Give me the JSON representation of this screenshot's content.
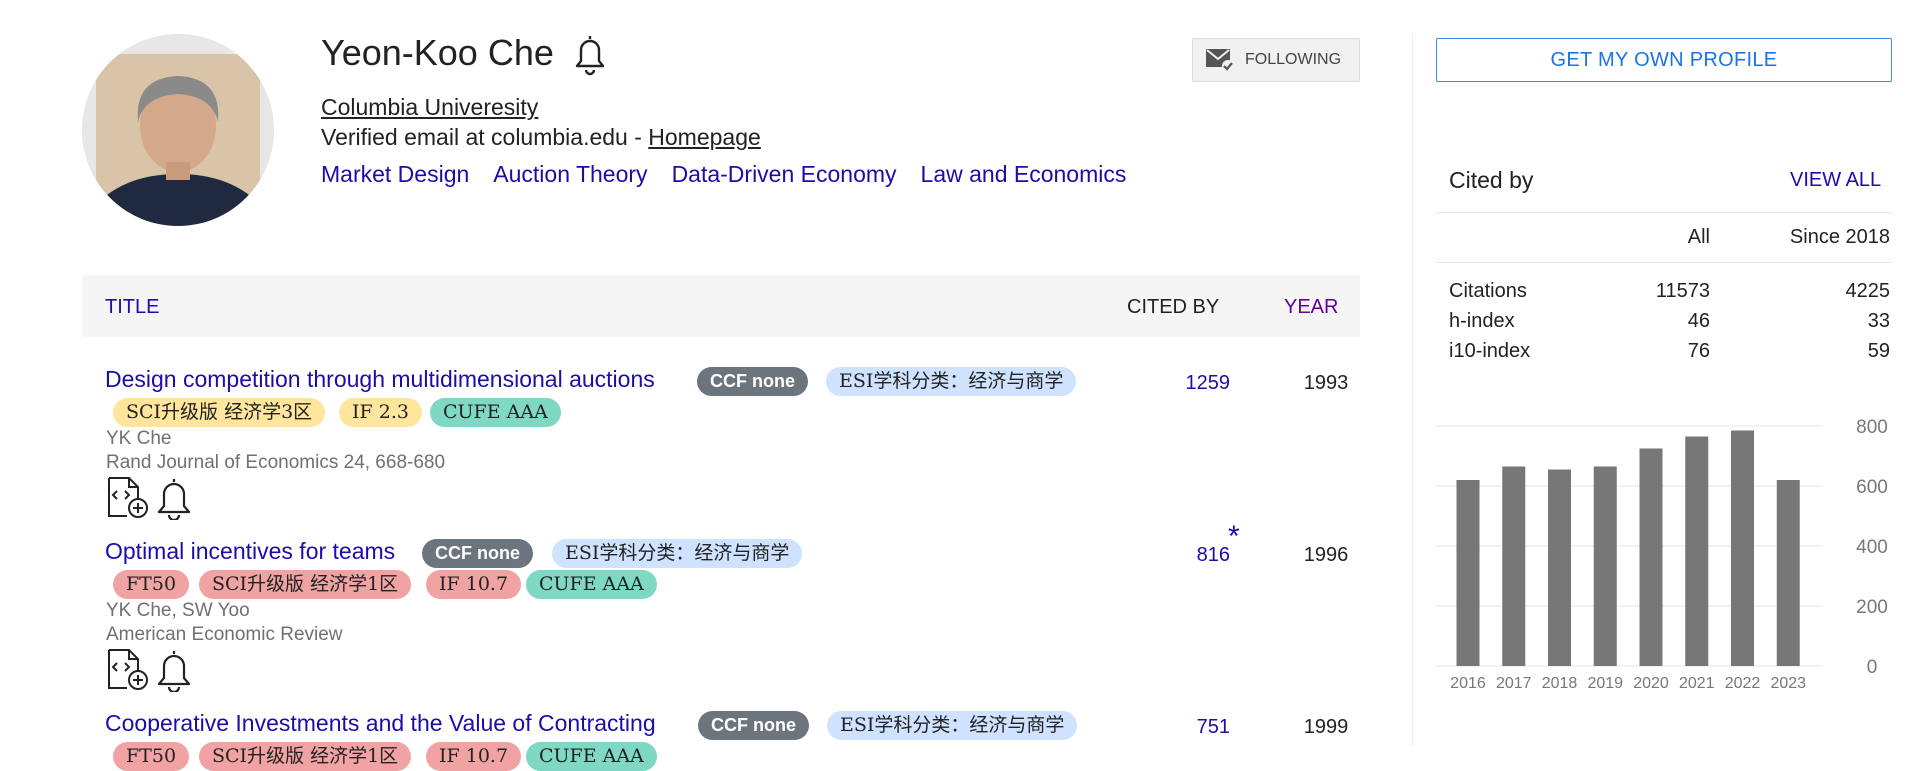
{
  "profile": {
    "name": "Yeon-Koo Che",
    "affiliation": "Columbia Univeresity",
    "email": "Verified email at columbia.edu - ",
    "homepage": "Homepage",
    "interests": [
      "Market Design",
      "Auction Theory",
      "Data-Driven Economy",
      "Law and Economics"
    ],
    "follow_label": "FOLLOWING"
  },
  "table": {
    "col_title": "TITLE",
    "col_cited": "CITED BY",
    "col_year": "YEAR"
  },
  "articles": [
    {
      "title": "Design competition through multidimensional auctions",
      "tags_row1": [
        "CCF none",
        "ESI学科分类：经济与商学"
      ],
      "tags_row2": [
        "SCI升级版 经济学3区",
        "IF 2.3",
        "CUFE AAA"
      ],
      "authors": "YK Che",
      "venue": "Rand Journal of Economics 24, 668-680",
      "cited": "1259",
      "year": "1993"
    },
    {
      "title": "Optimal incentives for teams",
      "tags_row1": [
        "CCF none",
        "ESI学科分类：经济与商学"
      ],
      "tags_row2": [
        "FT50",
        "SCI升级版 经济学1区",
        "IF 10.7",
        "CUFE AAA"
      ],
      "authors": "YK Che, SW Yoo",
      "venue": "American Economic Review",
      "cited": "816",
      "star": "*",
      "year": "1996"
    },
    {
      "title": "Cooperative Investments and the Value of Contracting",
      "tags_row1": [
        "CCF none",
        "ESI学科分类：经济与商学"
      ],
      "tags_row2": [
        "FT50",
        "SCI升级版 经济学1区",
        "IF 10.7",
        "CUFE AAA"
      ],
      "cited": "751",
      "year": "1999"
    }
  ],
  "sidebar": {
    "get_profile": "GET MY OWN PROFILE",
    "cited_by": "Cited by",
    "view_all": "VIEW ALL",
    "col_all": "All",
    "col_since": "Since 2018",
    "rows": [
      {
        "label": "Citations",
        "all": "11573",
        "since": "4225"
      },
      {
        "label": "h-index",
        "all": "46",
        "since": "33"
      },
      {
        "label": "i10-index",
        "all": "76",
        "since": "59"
      }
    ]
  },
  "chart_data": {
    "type": "bar",
    "categories": [
      "2016",
      "2017",
      "2018",
      "2019",
      "2020",
      "2021",
      "2022",
      "2023"
    ],
    "values": [
      620,
      665,
      655,
      665,
      725,
      765,
      785,
      620
    ],
    "ylim": [
      0,
      800
    ],
    "yticks": [
      "0",
      "200",
      "400",
      "600",
      "800"
    ],
    "grid": true,
    "bar_color": "#777777"
  }
}
